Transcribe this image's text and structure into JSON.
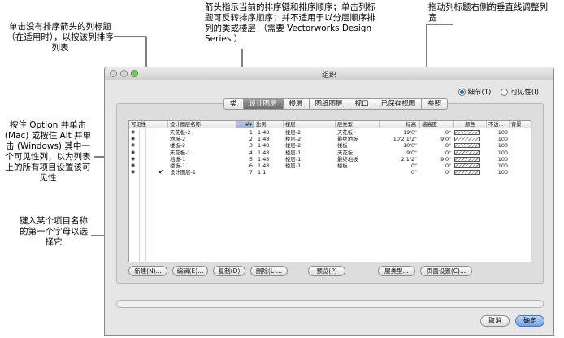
{
  "callouts": {
    "top_left": "单击没有排序箭头的列标题 （在适用时），以按该列排序列表",
    "top_center": "箭头指示当前的排序键和排序顺序；单击列标题可反转排序顺序；并不适用于以分层顺序排列的类或楼层 （需要 Vectorworks Design Series ）",
    "top_right": "拖动列标题右侧的垂直线调整列宽",
    "left_mid": "按住 Option 并单击 (Mac) 或按住 Alt 并单击 (Windows) 其中一个可见性列，以为列表上的所有项目设置该可见性",
    "left_low": "键入某个项目名称的第一个字母以选择它"
  },
  "window": {
    "title": "组织"
  },
  "view_options": [
    {
      "label": "细节(T)",
      "selected": true
    },
    {
      "label": "可见性(I)",
      "selected": false
    }
  ],
  "tabs": [
    {
      "label": "类",
      "active": false
    },
    {
      "label": "设计图层",
      "active": true
    },
    {
      "label": "楼层",
      "active": false
    },
    {
      "label": "图纸图层",
      "active": false
    },
    {
      "label": "视口",
      "active": false
    },
    {
      "label": "已保存视图",
      "active": false
    },
    {
      "label": "参照",
      "active": false
    }
  ],
  "table": {
    "headers": {
      "vis": "可见性",
      "name": "设计图层名称",
      "num": "#",
      "scale": "比例",
      "story": "楼层",
      "layer_type": "层类型",
      "elevation": "标高",
      "wall_height": "墙高度",
      "color": "颜色",
      "opacity": "不透...",
      "background": "背景"
    },
    "sort_indicator": "▾",
    "rows": [
      {
        "name": "天花板-2",
        "num": "1",
        "scale": "1:48",
        "story": "楼层-2",
        "layer_type": "天花板",
        "elevation": "19'0\"",
        "wall_height": "0\"",
        "opacity": "100",
        "checked": false
      },
      {
        "name": "地板-2",
        "num": "2",
        "scale": "1:48",
        "story": "楼层-2",
        "layer_type": "最终地板",
        "elevation": "10'2 1/2\"",
        "wall_height": "9'0\"",
        "opacity": "100",
        "checked": false
      },
      {
        "name": "楼板-2",
        "num": "3",
        "scale": "1:48",
        "story": "楼层-2",
        "layer_type": "楼板",
        "elevation": "10'0\"",
        "wall_height": "0\"",
        "opacity": "100",
        "checked": false
      },
      {
        "name": "天花板-1",
        "num": "4",
        "scale": "1:48",
        "story": "楼层-1",
        "layer_type": "天花板",
        "elevation": "9'0\"",
        "wall_height": "0\"",
        "opacity": "100",
        "checked": false
      },
      {
        "name": "地板-1",
        "num": "5",
        "scale": "1:48",
        "story": "楼层-1",
        "layer_type": "最终地板",
        "elevation": "2 1/2\"",
        "wall_height": "9'0\"",
        "opacity": "100",
        "checked": false
      },
      {
        "name": "楼板-1",
        "num": "6",
        "scale": "1:48",
        "story": "楼层-1",
        "layer_type": "楼板",
        "elevation": "0\"",
        "wall_height": "0\"",
        "opacity": "100",
        "checked": false
      },
      {
        "name": "设计图层-1",
        "num": "7",
        "scale": "1:1",
        "story": "",
        "layer_type": "",
        "elevation": "0\"",
        "wall_height": "0\"",
        "opacity": "100",
        "checked": true
      }
    ]
  },
  "buttons": {
    "new": "新建(N)...",
    "edit": "编辑(E)...",
    "duplicate": "复制(D)",
    "delete": "删除(L)...",
    "preview": "预览(P)",
    "layer_type": "层类型...",
    "page_setup": "页面设置(C)...",
    "cancel": "取消",
    "ok": "确定"
  },
  "icons": {
    "visibility": "eye-icon",
    "checkmark": "checkmark-icon"
  },
  "colors": {
    "active_tab": "#7a7a7a",
    "ok_button": "#6fa0e6",
    "sorted_header": "#a9bde0"
  }
}
